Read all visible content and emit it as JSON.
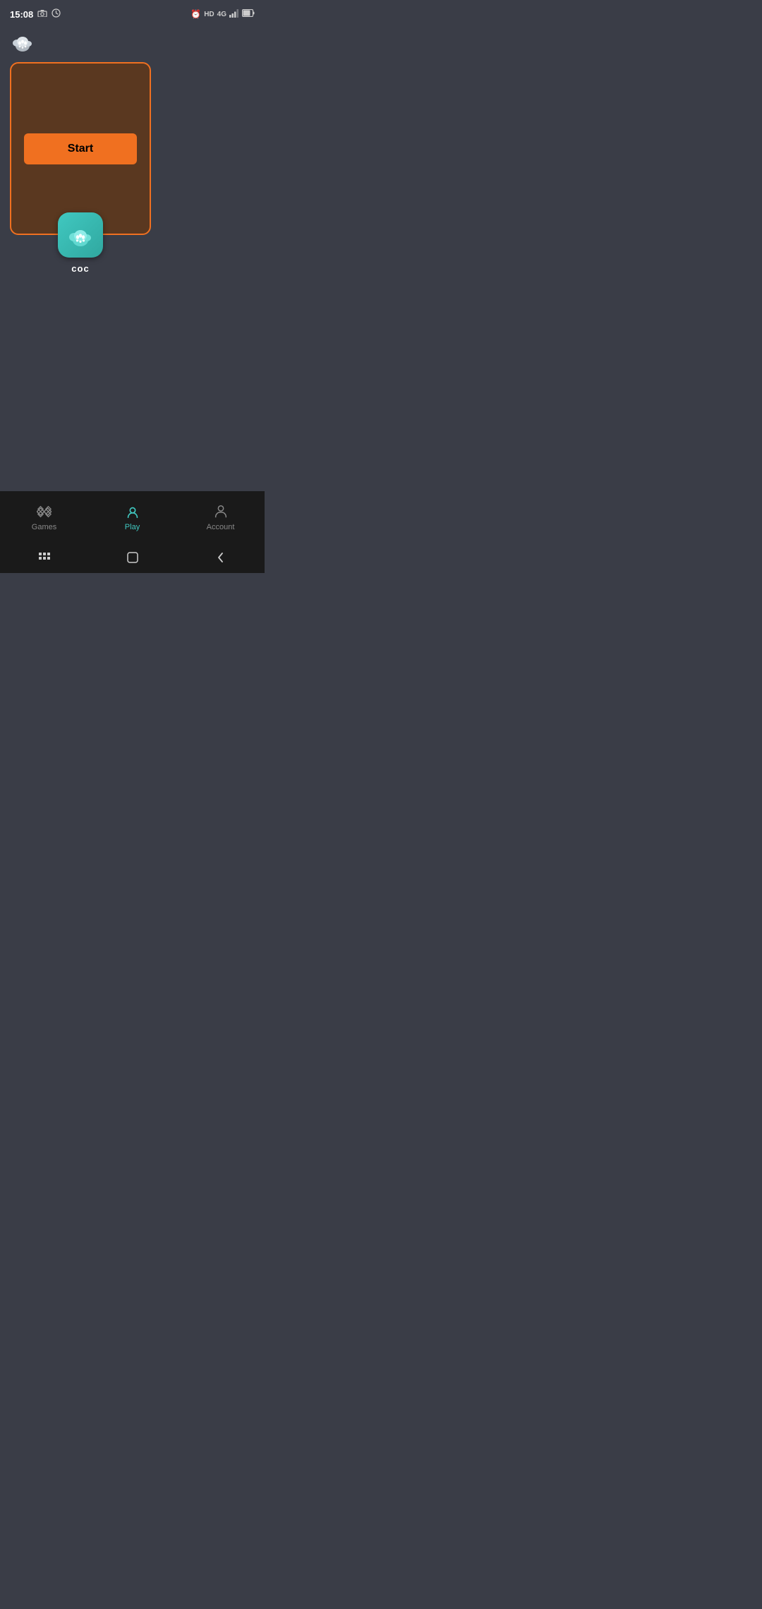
{
  "statusBar": {
    "time": "15:08",
    "leftIcons": [
      "photo-icon",
      "history-icon"
    ],
    "rightIcons": [
      "alarm-icon",
      "hd-label",
      "4g-icon",
      "signal-icon",
      "battery-icon"
    ],
    "hd": "HD",
    "network": "4G"
  },
  "appLogo": {
    "iconLabel": "paw-cloud-icon"
  },
  "gameCard": {
    "startButtonLabel": "Start",
    "gameIconLabel": "coc-icon",
    "gameName": "coc",
    "borderColor": "#f07020",
    "backgroundColor": "#5a3820"
  },
  "bottomNav": {
    "items": [
      {
        "id": "games",
        "label": "Games",
        "active": false
      },
      {
        "id": "play",
        "label": "Play",
        "active": true
      },
      {
        "id": "account",
        "label": "Account",
        "active": false
      }
    ]
  },
  "androidNav": {
    "buttons": [
      "recent-apps-icon",
      "home-icon",
      "back-icon"
    ]
  }
}
